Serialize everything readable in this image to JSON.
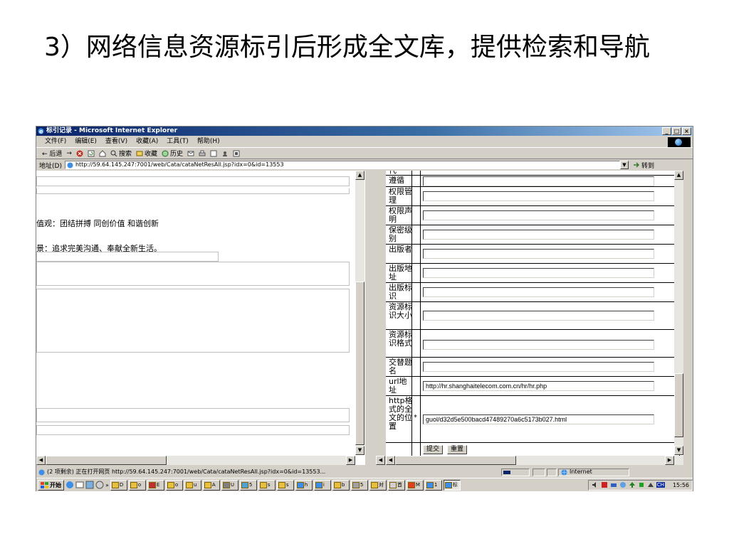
{
  "slide": {
    "title": "3）网络信息资源标引后形成全文库，提供检索和导航"
  },
  "window": {
    "title": "标引记录 - Microsoft Internet Explorer",
    "buttons": [
      "_",
      "□",
      "×"
    ]
  },
  "menu": [
    "文件(F)",
    "编辑(E)",
    "查看(V)",
    "收藏(A)",
    "工具(T)",
    "帮助(H)"
  ],
  "toolbar": {
    "back": "← 后退",
    "forward": "→",
    "search": "搜索",
    "favorites": "收藏",
    "history": "历史"
  },
  "address": {
    "label": "地址(D)",
    "url": "http://59.64.145.247:7001/web/Cata/cataNetResAll.jsp?idx=0&id=13553",
    "go": "转到"
  },
  "left_frame": {
    "text1": "值观：团结拼搏 同创价值 和谐创新",
    "text2": "景：追求完美沟通、奉献全新生活。"
  },
  "right_frame": {
    "top_label": "代",
    "rows": [
      {
        "label": "遵循",
        "value": ""
      },
      {
        "label": "权限管理",
        "value": ""
      },
      {
        "label": "权限声明",
        "value": ""
      },
      {
        "label": "保密级别",
        "value": ""
      },
      {
        "label": "出版者",
        "value": ""
      },
      {
        "label": "出版地址",
        "value": ""
      },
      {
        "label": "出版标识",
        "value": ""
      },
      {
        "label": "资源标识大小",
        "value": ""
      },
      {
        "label": "资源标识格式",
        "value": ""
      },
      {
        "label": "交替题名",
        "value": ""
      },
      {
        "label": "url地址",
        "value": "http://hr.shanghaitelecom.com.cn/hr/hr.php"
      },
      {
        "label": "http格式的全文的位置",
        "value": "guol/d32d5e500bacd47489270a6c5173b027.html",
        "required": "*"
      }
    ],
    "submit": "提交",
    "reset": "重置"
  },
  "status": {
    "text": "(2 项剩余) 正在打开网页 http://59.64.145.247:7001/web/Cata/cataNetResAll.jsp?idx=0&id=13553...",
    "zone": "Internet"
  },
  "taskbar": {
    "start": "开始",
    "tasks": [
      "D",
      "o",
      "E",
      "o",
      "u",
      "A",
      "U",
      "5",
      "s",
      "s",
      "h",
      "i",
      "b",
      "5",
      "对",
      "首",
      "M",
      "1",
      "标"
    ],
    "lang": "CH",
    "clock": "15:56"
  },
  "colors": {
    "titlebar_start": "#0a246a",
    "titlebar_end": "#a6caf0",
    "chrome": "#d4d0c8"
  }
}
